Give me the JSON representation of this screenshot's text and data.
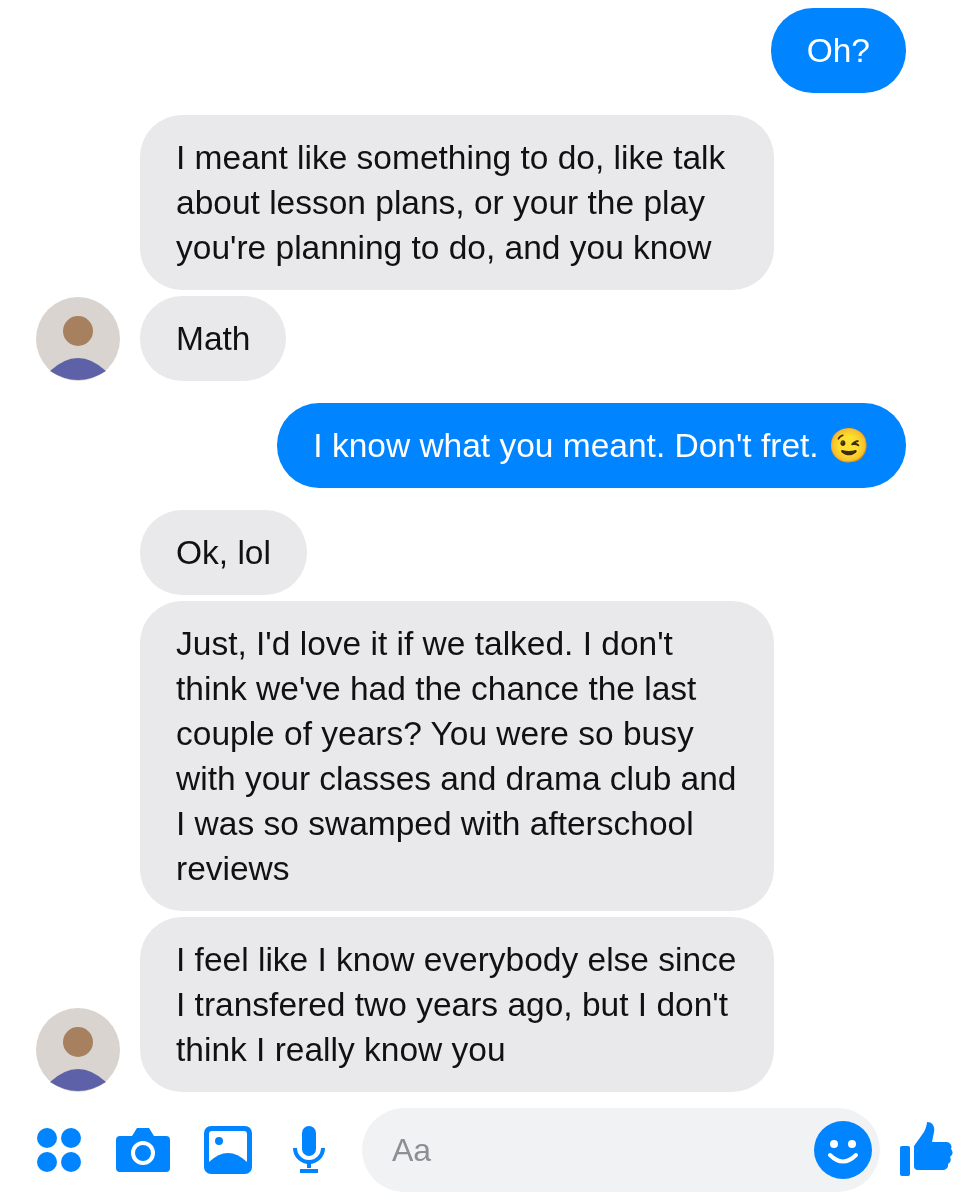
{
  "messages": [
    {
      "kind": "outgoing",
      "text": "Oh?",
      "avatar": false
    },
    {
      "kind": "incoming",
      "text": "I meant like something to do, like talk about lesson plans, or your the play you're planning to do, and you know",
      "avatar": false
    },
    {
      "kind": "incoming",
      "text": "Math",
      "avatar": true
    },
    {
      "kind": "outgoing",
      "text": "I know what you meant. Don't fret. 😉",
      "avatar": false
    },
    {
      "kind": "incoming",
      "text": "Ok, lol",
      "avatar": false
    },
    {
      "kind": "incoming",
      "text": "Just, I'd love it if we talked. I don't think we've had the chance the last couple of years? You were so busy with your classes and drama club and I was so swamped with afterschool reviews",
      "avatar": false
    },
    {
      "kind": "incoming",
      "text": "I feel like I know everybody else since I transfered two years ago, but I don't think I really know you",
      "avatar": true
    }
  ],
  "composer": {
    "placeholder": "Aa"
  }
}
